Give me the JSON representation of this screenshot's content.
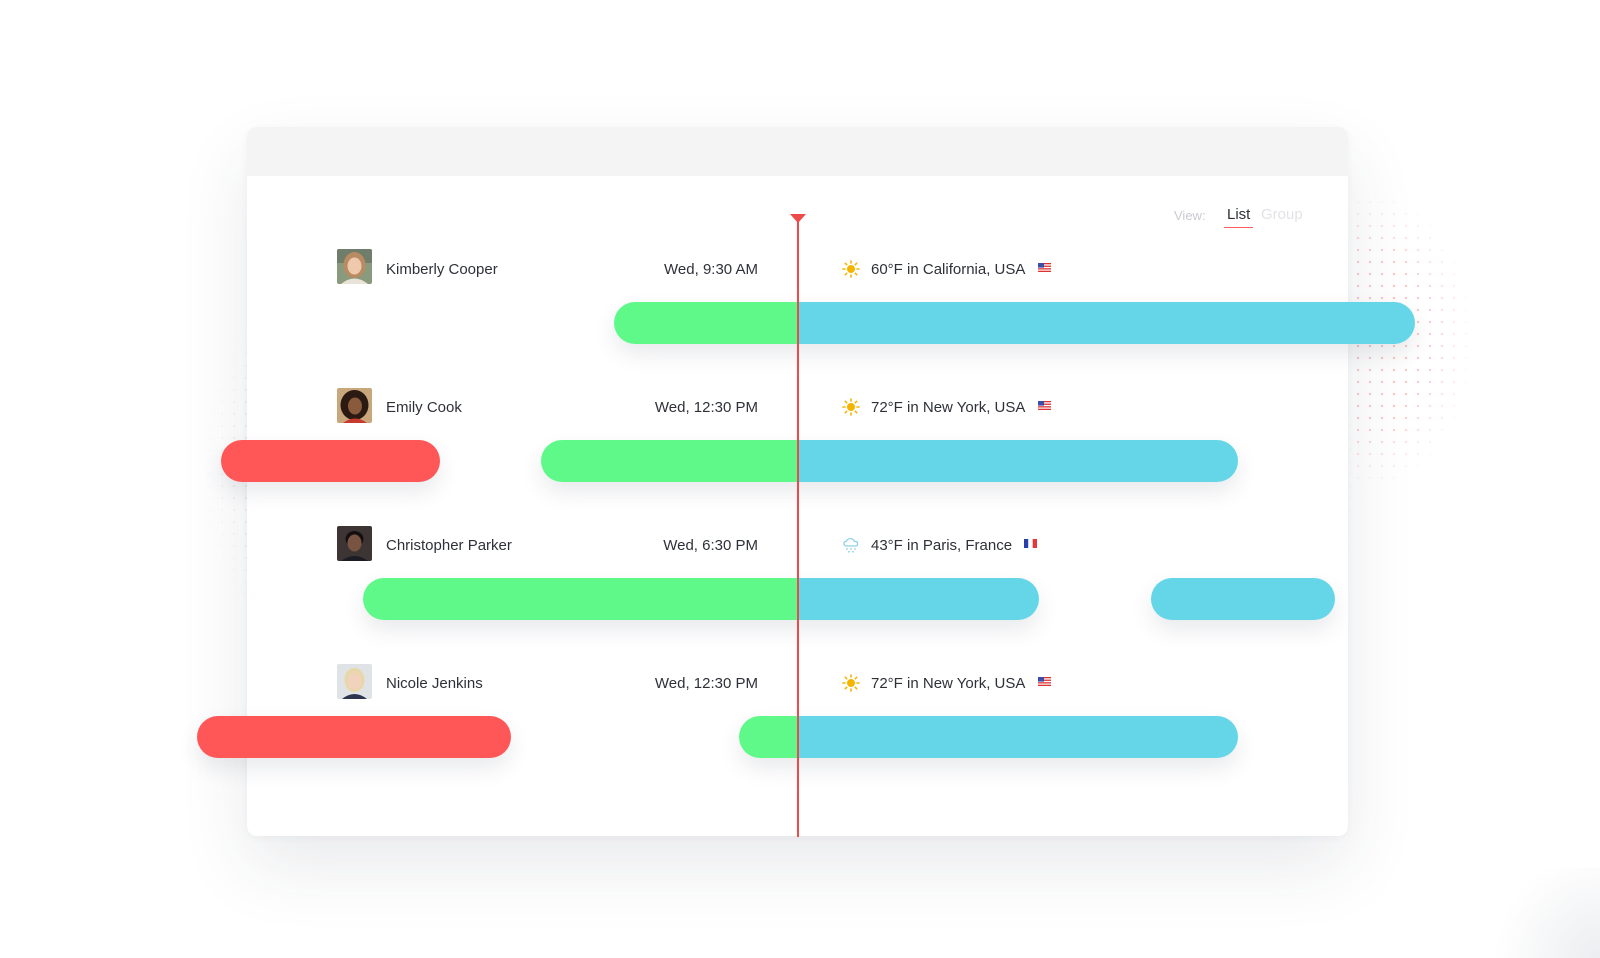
{
  "view_switch": {
    "label": "View:",
    "options": [
      "List",
      "Group"
    ],
    "selected": "List"
  },
  "people": [
    {
      "name": "Kimberly Cooper",
      "local_time": "Wed, 9:30 AM",
      "weather_icon": "sun-icon",
      "weather": "60°F in California, USA",
      "flag": "us-flag-icon"
    },
    {
      "name": "Emily Cook",
      "local_time": "Wed, 12:30 PM",
      "weather_icon": "sun-icon",
      "weather": "72°F in New York, USA",
      "flag": "us-flag-icon"
    },
    {
      "name": "Christopher Parker",
      "local_time": "Wed, 6:30 PM",
      "weather_icon": "snow-cloud-icon",
      "weather": "43°F in Paris, France",
      "flag": "fr-flag-icon"
    },
    {
      "name": "Nicole Jenkins",
      "local_time": "Wed, 12:30 PM",
      "weather_icon": "sun-icon",
      "weather": "72°F in New York, USA",
      "flag": "us-flag-icon"
    }
  ],
  "colors": {
    "offline": "#ff5757",
    "working_past": "#5ff98a",
    "working_upcoming": "#64d6e8",
    "now_indicator": "#ee4a4a",
    "view_underline": "#ff5a5a"
  }
}
